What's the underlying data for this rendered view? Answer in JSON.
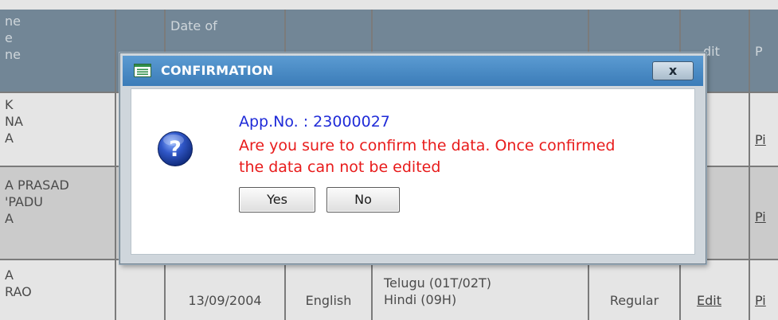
{
  "table": {
    "headers": {
      "name_fragment": [
        "ne",
        "e",
        "ne"
      ],
      "date_of": "Date of",
      "edit": "dit",
      "print_fragment": "P"
    },
    "rows": [
      {
        "name_fragment": [
          "K",
          "NA",
          "A"
        ],
        "print_fragment": "Pi"
      },
      {
        "name_fragment": [
          "A PRASAD",
          "'PADU",
          "A"
        ],
        "print_fragment": "Pi"
      },
      {
        "name_fragment": [
          "A",
          "",
          "RAO"
        ],
        "date": "13/09/2004",
        "medium": "English",
        "languages": [
          "Telugu (01T/02T)",
          "Hindi (09H)"
        ],
        "type": "Regular",
        "edit": "Edit",
        "print_fragment": "Pi"
      }
    ]
  },
  "dialog": {
    "title": "CONFIRMATION",
    "close_label": "x",
    "app_no": "App.No. : 23000027",
    "message": "Are you sure to confirm the data. Once confirmed the data can not be edited",
    "yes_label": "Yes",
    "no_label": "No"
  },
  "colors": {
    "header_bg": "#7f96a8",
    "titlebar": "#4a8bc5",
    "app_no": "#1f2bd8",
    "message": "#e81b1b"
  },
  "icons": {
    "title": "window-icon",
    "question": "question-icon"
  }
}
